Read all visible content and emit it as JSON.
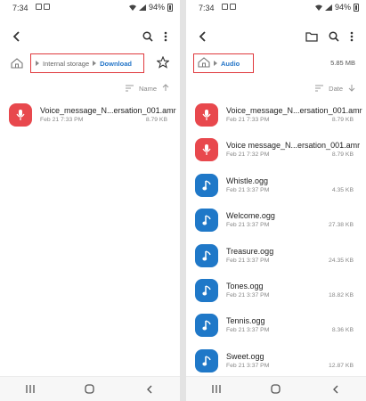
{
  "left": {
    "status": {
      "time": "7:34",
      "battery": "94%"
    },
    "breadcrumb": {
      "items": [
        "Internal storage",
        "Download"
      ]
    },
    "sort": {
      "label": "Name"
    },
    "files": [
      {
        "name": "Voice_message_N...ersation_001.amr",
        "date": "Feb 21 7:33 PM",
        "size": "8.79 KB",
        "type": "voice"
      }
    ]
  },
  "right": {
    "status": {
      "time": "7:34",
      "battery": "94%"
    },
    "breadcrumb": {
      "items": [
        "Audio"
      ]
    },
    "storage_size": "5.85 MB",
    "sort": {
      "label": "Date"
    },
    "files": [
      {
        "name": "Voice_message_N...ersation_001.amr",
        "date": "Feb 21 7:33 PM",
        "size": "8.79 KB",
        "type": "voice"
      },
      {
        "name": "Voice message_N...ersation_001.amr",
        "date": "Feb 21 7:32 PM",
        "size": "8.79 KB",
        "type": "voice"
      },
      {
        "name": "Whistle.ogg",
        "date": "Feb 21 3:37 PM",
        "size": "4.35 KB",
        "type": "audio"
      },
      {
        "name": "Welcome.ogg",
        "date": "Feb 21 3:37 PM",
        "size": "27.38 KB",
        "type": "audio"
      },
      {
        "name": "Treasure.ogg",
        "date": "Feb 21 3:37 PM",
        "size": "24.35 KB",
        "type": "audio"
      },
      {
        "name": "Tones.ogg",
        "date": "Feb 21 3:37 PM",
        "size": "18.82 KB",
        "type": "audio"
      },
      {
        "name": "Tennis.ogg",
        "date": "Feb 21 3:37 PM",
        "size": "8.36 KB",
        "type": "audio"
      },
      {
        "name": "Sweet.ogg",
        "date": "Feb 21 3:37 PM",
        "size": "12.87 KB",
        "type": "audio"
      }
    ]
  },
  "colors": {
    "voice_icon": "#e8484d",
    "audio_icon": "#1f78c8",
    "highlight_box": "#e0393e",
    "active_crumb": "#2576c8"
  },
  "icons": {
    "back": "back-arrow-icon",
    "search": "search-icon",
    "more": "more-vert-icon",
    "folder": "new-folder-icon",
    "star": "star-icon",
    "home": "home-icon",
    "sort": "sort-icon",
    "voice": "microphone-icon",
    "audio": "music-note-icon",
    "recents": "recents-icon",
    "home_nav": "home-nav-icon",
    "back_nav": "back-nav-icon"
  }
}
